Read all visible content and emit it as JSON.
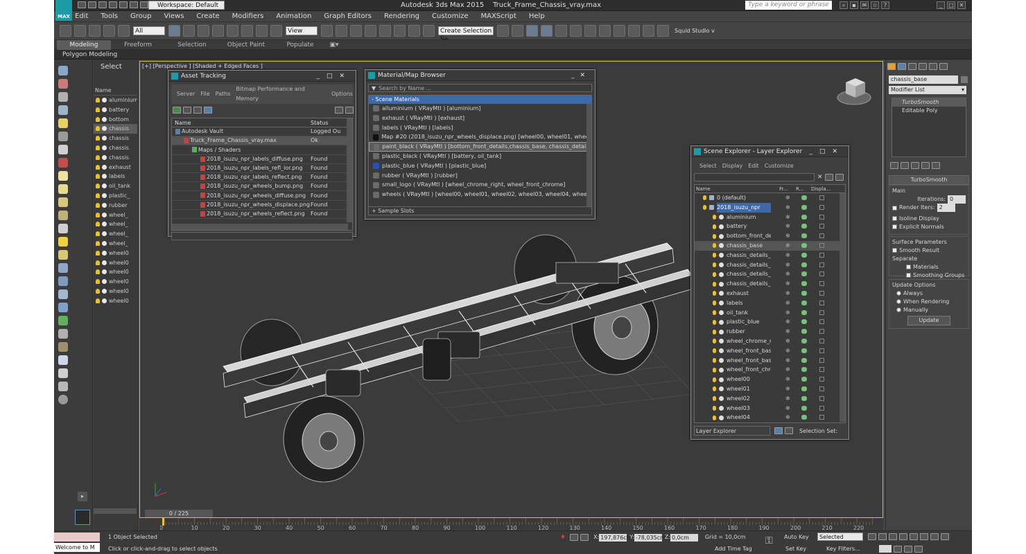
{
  "title_bar": {
    "app_title": "Autodesk 3ds Max 2015",
    "file_name": "Truck_Frame_Chassis_vray.max",
    "workspace": "Workspace: Default",
    "search_placeholder": "Type a keyword or phrase",
    "logo_text": "MAX"
  },
  "menu": [
    "Edit",
    "Tools",
    "Group",
    "Views",
    "Create",
    "Modifiers",
    "Animation",
    "Graph Editors",
    "Rendering",
    "Customize",
    "MAXScript",
    "Help"
  ],
  "toolbar": {
    "selection_filter": "All",
    "ref_coord": "View",
    "selection_set": "Create Selection Se",
    "studio_label": "Squid Studio v"
  },
  "ribbon": {
    "tabs": [
      "Modeling",
      "Freeform",
      "Selection",
      "Object Paint",
      "Populate"
    ],
    "active": "Modeling",
    "sub_label": "Polygon Modeling"
  },
  "scene_list": {
    "select_label": "Select",
    "column": "Name",
    "items": [
      "aluminium",
      "battery",
      "bottom",
      "chassis",
      "chassis",
      "chassis",
      "chassis",
      "exhaust",
      "labels",
      "oil_tank",
      "plastic_",
      "rubber",
      "wheel_",
      "wheel_",
      "wheel_",
      "wheel_",
      "wheel0",
      "wheel0",
      "wheel0",
      "wheel0",
      "wheel0",
      "wheel0"
    ]
  },
  "viewport": {
    "label": "[+] [Perspective ] [Shaded + Edged Faces ]"
  },
  "asset_tracking": {
    "title": "Asset Tracking",
    "menu": [
      "Server",
      "File",
      "Paths",
      "Bitmap Performance and Memory",
      "Options"
    ],
    "columns": [
      "Name",
      "Status"
    ],
    "rows": [
      {
        "name": "Autodesk Vault",
        "status": "Logged Ou"
      },
      {
        "name": "Truck_Frame_Chassis_vray.max",
        "status": "Ok"
      },
      {
        "name": "Maps / Shaders",
        "status": ""
      },
      {
        "name": "2018_isuzu_npr_labels_diffuse.png",
        "status": "Found"
      },
      {
        "name": "2018_isuzu_npr_labels_refl_ior.png",
        "status": "Found"
      },
      {
        "name": "2018_isuzu_npr_labels_reflect.png",
        "status": "Found"
      },
      {
        "name": "2018_isuzu_npr_wheels_bump.png",
        "status": "Found"
      },
      {
        "name": "2018_isuzu_npr_wheels_diffuse.png",
        "status": "Found"
      },
      {
        "name": "2018_isuzu_npr_wheels_displace.png",
        "status": "Found"
      },
      {
        "name": "2018_isuzu_npr_wheels_reflect.png",
        "status": "Found"
      }
    ]
  },
  "material_browser": {
    "title": "Material/Map Browser",
    "search_placeholder": "Search by Name ...",
    "section": "- Scene Materials",
    "items": [
      "alluminium  ( VRayMtl )  [aluminium]",
      "exhaust  ( VRayMtl )  [exhaust]",
      "labels  ( VRayMtl )  [labels]",
      "Map #20 (2018_isuzu_npr_wheels_displace.png)  [wheel00, wheel01, wheel02,...",
      "paint_black ( VRayMtl ) [bottom_front_details,chassis_base, chassis_details_1,...",
      "plastic_black  ( VRayMtl )  [battery, oil_tank]",
      "plastic_blue  ( VRayMtl )  [plastic_blue]",
      "rubber  ( VRayMtl )  [rubber]",
      "small_logo  ( VRayMtl )  [wheel_chrome_right, wheel_front_chrome]",
      "wheels  ( VRayMtl )  [wheel00, wheel01, wheel02, wheel03, wheel04, wheel05]"
    ],
    "footer": "+ Sample Slots"
  },
  "scene_explorer": {
    "title": "Scene Explorer - Layer Explorer",
    "menu": [
      "Select",
      "Display",
      "Edit",
      "Customize"
    ],
    "columns": [
      "Name",
      "Fr...",
      "R...",
      "Displa..."
    ],
    "layers": [
      "0 (default)",
      "2018_isuzu_npr"
    ],
    "items": [
      "aluminium",
      "battery",
      "bottom_front_details",
      "chassis_base",
      "chassis_details_1",
      "chassis_details_2",
      "chassis_details_3",
      "chassis_details_4",
      "exhaust",
      "labels",
      "oil_tank",
      "plastic_blue",
      "rubber",
      "wheel_chrome_right",
      "wheel_front_base_...",
      "wheel_front_base_...",
      "wheel_front_chrome",
      "wheel00",
      "wheel01",
      "wheel02",
      "wheel03",
      "wheel04"
    ],
    "footer_left": "Layer Explorer",
    "footer_right": "Selection Set:"
  },
  "command_panel": {
    "object_name": "chassis_base",
    "modifier_list": "Modifier List",
    "stack": [
      "TurboSmooth",
      "Editable Poly"
    ],
    "rollout": "TurboSmooth",
    "main_label": "Main",
    "iterations_label": "Iterations:",
    "iterations": "0",
    "render_iters_label": "Render Iters:",
    "render_iters": "2",
    "isoline": "Isoline Display",
    "explicit": "Explicit Normals",
    "surface_params": "Surface Parameters",
    "smooth_result": "Smooth Result",
    "separate": "Separate",
    "materials": "Materials",
    "smoothing_groups": "Smoothing Groups",
    "update_options": "Update Options",
    "always": "Always",
    "when_rendering": "When Rendering",
    "manually": "Manually",
    "update_button": "Update"
  },
  "timeline": {
    "frame": "0 / 225",
    "ticks": [
      "0",
      "10",
      "20",
      "30",
      "40",
      "50",
      "60",
      "70",
      "80",
      "90",
      "100",
      "110",
      "120",
      "130",
      "140",
      "150",
      "160",
      "170",
      "180",
      "190",
      "200",
      "210",
      "220"
    ]
  },
  "status_bar": {
    "maxscript": "Welcome to M",
    "objects_selected": "1 Object Selected",
    "prompt": "Click or click-and-drag to select objects",
    "x_label": "X:",
    "x": "197,876cm",
    "y_label": "Y:",
    "y": "-78,035cm",
    "z_label": "Z:",
    "z": "0,0cm",
    "grid": "Grid = 10,0cm",
    "add_time_tag": "Add Time Tag",
    "auto_key": "Auto Key",
    "set_key": "Set Key",
    "selected": "Selected",
    "key_filters": "Key Filters..."
  }
}
